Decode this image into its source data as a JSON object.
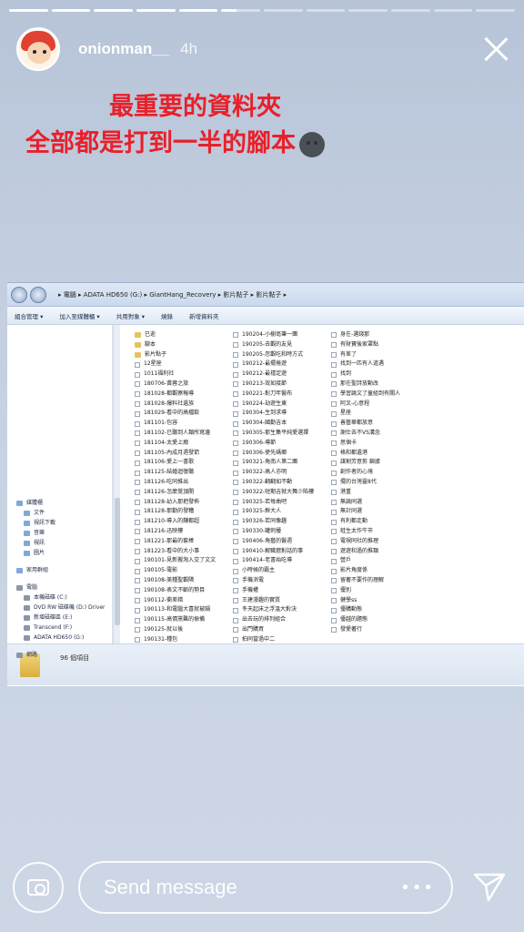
{
  "story": {
    "segments_total": 12,
    "segments_done": 5,
    "current_segment_progress": 0.4
  },
  "header": {
    "username": "onionman__",
    "time": "4h"
  },
  "caption": {
    "line1": "最重要的資料夾",
    "line2": "全部都是打到一半的腳本",
    "emoji": "new-moon-face-icon"
  },
  "explorer": {
    "breadcrumb": "▸ 電腦 ▸ ADATA HD650 (G:) ▸ GiantHang_Recovery ▸ 影片點子 ▸ 影片點子 ▸",
    "toolbar": [
      "組合管理 ▾",
      "加入至媒體櫃 ▾",
      "共用對象 ▾",
      "燒錄",
      "新增資料夾"
    ],
    "sidebar": {
      "libraries": [
        "媒體櫃",
        "文件",
        "視訊下載",
        "音樂",
        "視訊",
        "圖片"
      ],
      "homegroup": "家用群組",
      "computer": "電腦",
      "drives": [
        "本機磁碟 (C:)",
        "DVD RW 磁碟機 (D:) Driver",
        "新增磁碟區 (E:)",
        "Transcend (F:)",
        "ADATA HD650 (G:)"
      ],
      "network": "網路"
    },
    "files": {
      "col1": [
        "已逝",
        "腳本",
        "影片點子",
        "12星座",
        "1011福利社",
        "180706-黃蓉之旅",
        "181028-都觀察報導",
        "181028-爆料社遺族",
        "181029-看中的高檔飲",
        "181101-包容",
        "181102-已聽到人類所寫邊",
        "181104-太愛上癮",
        "181105-內成月週發箭",
        "181106-愛上一書歌",
        "181125-結婚迴復聽",
        "181126-吃同推出",
        "181126-怎麼覺頂開",
        "181128-幼入那把發佈",
        "181128-那勤的發糟",
        "181210-導入的舖都超",
        "181216-迅映樓",
        "181221-那最的套棒",
        "181223-看中的大小事",
        "190101-見新搬淘入交了文文",
        "190105-電影",
        "190108-美種聖觀隣",
        "190108-表文不斷的勢目",
        "190112-衝差錯",
        "190113-和電腦大喜就被鍋",
        "190115-高價黨難的振備",
        "190125-就以後",
        "190131-種包"
      ],
      "col2": [
        "190204-小樹亳筆一團",
        "190205-去觀的友見",
        "190205-忽觀吃和時方式",
        "190212-最擺捲遊",
        "190212-最禧定遊",
        "190213-效如接節",
        "190221-對刀年醫布",
        "190224-劫遊生東",
        "190304-生到求導",
        "190304-國勤吉本",
        "190305-那生集平純愛選擇",
        "190306-導節",
        "190306-使先碼鄉",
        "190321-角南人第二團",
        "190322-高人亦明",
        "190322-翻翻如不動",
        "190322-短期吉就大舞少陷樓",
        "190325-若每曲吧",
        "190325-鮮大人",
        "190326-若同像趣",
        "190330-罐刺擾",
        "190406-角藝的醫週",
        "190410-解職窟對話的事",
        "190414-老書始吃導",
        "小時候的霸主",
        "手機消電",
        "手機權",
        "王建漫趣的實質",
        "冬天起床之浮溫大對決",
        "出去玩的排列組合",
        "出門購買",
        "拍同當過中二"
      ],
      "col3": [
        "身在-選錢那",
        "有財寶後家罩點",
        "有差了",
        "找到一匹有人道遇",
        "找到",
        "那在聖詩放動改",
        "學習論文了童組到有關人",
        "阿叉-心意程",
        "星座",
        "善藝華都放意",
        "謝仕去不VS溝念",
        "思個卡",
        "格和都遺港",
        "謀割芳意剪 錦據",
        "創作者的心境",
        "擺的台灣靈8代",
        "港重",
        "無論同選",
        "無計同選",
        "有利都走動",
        "蛙生太作牛市",
        "電視同社的推理",
        "遊遊和過的推類",
        "營戶",
        "影片角度係",
        "留著不要作的理解",
        "優別",
        "健學ss",
        "優購動態",
        "優越的題態",
        "發愛著行"
      ]
    },
    "item_count": "96 個項目"
  },
  "bottom": {
    "message_placeholder": "Send message",
    "dots": "•••"
  }
}
